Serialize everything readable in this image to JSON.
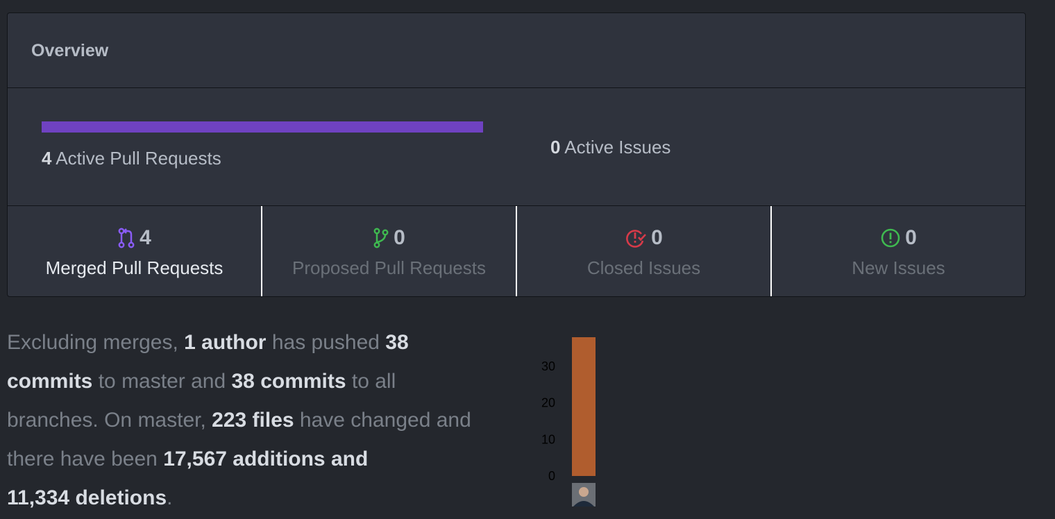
{
  "overview": {
    "title": "Overview",
    "active_pull_requests": {
      "count": "4",
      "label": "Active Pull Requests"
    },
    "active_issues": {
      "count": "0",
      "label": "Active Issues"
    },
    "accent_pr": "#6f42c1",
    "stats": [
      {
        "icon": "git-merge-icon",
        "count": "4",
        "label": "Merged Pull Requests",
        "color": "#8a5cf6"
      },
      {
        "icon": "git-pull-request-icon",
        "count": "0",
        "label": "Proposed Pull Requests",
        "color": "#3fb950"
      },
      {
        "icon": "issue-closed-icon",
        "count": "0",
        "label": "Closed Issues",
        "color": "#d73a49"
      },
      {
        "icon": "issue-opened-icon",
        "count": "0",
        "label": "New Issues",
        "color": "#3fb950"
      }
    ]
  },
  "summary": {
    "p1": "Excluding merges, ",
    "authors": "1 author",
    "p2": " has pushed ",
    "commits_master": "38 commits",
    "p3": " to master and ",
    "commits_all": "38 commits",
    "p4": " to all branches. On master, ",
    "files": "223 files",
    "p5": " have changed and there have been ",
    "additions": "17,567 additions",
    "p6": " and ",
    "deletions": "11,334 deletions",
    "p7": "."
  },
  "chart_data": {
    "type": "bar",
    "categories": [
      "author"
    ],
    "values": [
      38
    ],
    "ylim": [
      0,
      38
    ],
    "yticks": [
      "0",
      "10",
      "20",
      "30"
    ],
    "color": "#b05d2e"
  }
}
